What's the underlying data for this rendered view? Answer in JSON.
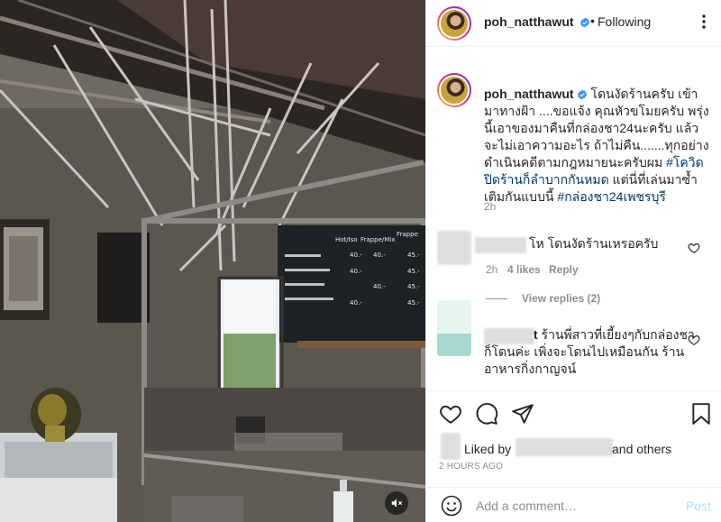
{
  "post": {
    "username": "poh_natthawut",
    "follow_label": "Following",
    "dot": "•",
    "caption": {
      "username": "poh_natthawut",
      "text_before_tags": "โดนงัดร้านครับ เข้ามาทางฝ้า ....ขอแจ้ง คุณหัวขโมยครับ พรุ่งนี้เอาของมาคืนที่กล่องชา24นะครับ แล้วจะไม่เอาความอะไร ถ้าไม่คืน.......ทุกอย่างดำเนินคดีตามกฎหมายนะครับผม ",
      "tag1": "#โควิดปิดร้านก็ลำบากกันหมด",
      "text_between_tags": " แต่นี่ที่เล่นมาซ้ำเติมกันแบบนี้ ",
      "tag2": "#กล่องชา24เพชรบุรี",
      "time": "2h"
    },
    "comments": [
      {
        "text": "โห โดนงัดร้านเหรอครับ",
        "time": "2h",
        "likes": "4 likes",
        "reply_label": "Reply",
        "view_replies": "View replies (2)"
      },
      {
        "name_suffix": "t",
        "text": "ร้านพี่สาวที่เยี้ยงๆกับกล่องชาก็โดนค่ะ เพิ่งจะโดนไปเหมือนกัน ร้านอาหารกิ่งกาญจน์"
      }
    ],
    "liked_by_prefix": "Liked by",
    "liked_by_suffix": "and others",
    "time_ago": "2 HOURS AGO",
    "add_comment": {
      "placeholder": "Add a comment…",
      "post_label": "Post"
    },
    "media": {
      "menu_board_headers": [
        "Hot/Iso",
        "Frappe/Mix",
        "Frappe"
      ],
      "menu_prices": [
        "40.-",
        "40.-",
        "45.-",
        "40.-",
        "45.-",
        "40.-",
        "45.-",
        "40.-",
        "45.-"
      ]
    }
  },
  "colors": {
    "tag": "#00376b",
    "muted": "#8e8e8e",
    "post_disabled": "#b2dffc",
    "verified": "#3897f0"
  },
  "icons": {
    "verified": "verified-badge-icon",
    "more": "more-options-icon",
    "heart": "heart-icon",
    "comment": "comment-icon",
    "share": "share-icon",
    "save": "bookmark-icon",
    "emoji": "emoji-icon",
    "mute": "muted-speaker-icon"
  }
}
